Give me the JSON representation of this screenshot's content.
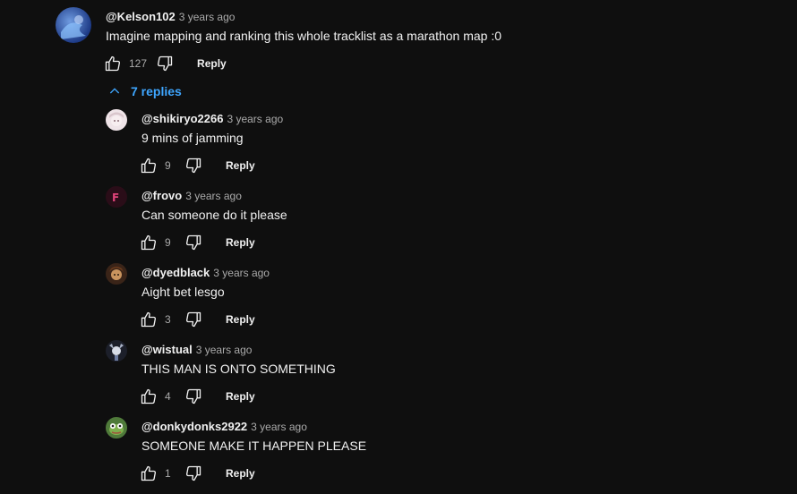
{
  "top_comment": {
    "author": "@Kelson102",
    "time": "3 years ago",
    "text": "Imagine mapping and ranking this whole tracklist as a marathon map :0",
    "likes": "127",
    "reply_label": "Reply"
  },
  "replies_toggle": {
    "label": "7 replies"
  },
  "replies": [
    {
      "author": "@shikiryo2266",
      "time": "3 years ago",
      "text": "9 mins of jamming",
      "likes": "9",
      "reply_label": "Reply"
    },
    {
      "author": "@frovo",
      "time": "3 years ago",
      "text": "Can someone do it please",
      "likes": "9",
      "reply_label": "Reply"
    },
    {
      "author": "@dyedblack",
      "time": "3 years ago",
      "text": "Aight bet lesgo",
      "likes": "3",
      "reply_label": "Reply"
    },
    {
      "author": "@wistual",
      "time": "3 years ago",
      "text": "THIS MAN IS ONTO SOMETHING",
      "likes": "4",
      "reply_label": "Reply"
    },
    {
      "author": "@donkydonks2922",
      "time": "3 years ago",
      "text": "SOMEONE MAKE IT HAPPEN PLEASE",
      "likes": "1",
      "reply_label": "Reply"
    }
  ],
  "icons": {
    "like": "thumbs-up-icon",
    "dislike": "thumbs-down-icon",
    "toggle": "chevron-up-icon"
  },
  "colors": {
    "background": "#0f0f0f",
    "text": "#f1f1f1",
    "secondary": "#aaaaaa",
    "link": "#3ea6ff"
  }
}
